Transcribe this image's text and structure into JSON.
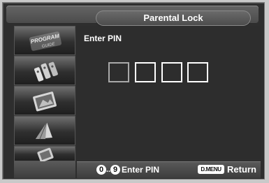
{
  "header": {
    "title": "Parental Lock"
  },
  "side_menu": {
    "items": [
      {
        "icon": "program-guide-icon",
        "caption": "PROGRAM GUIDE"
      },
      {
        "icon": "channel-icon"
      },
      {
        "icon": "picture-icon"
      },
      {
        "icon": "sound-icon"
      },
      {
        "icon": "setup-icon"
      }
    ],
    "selected_index": 0
  },
  "main": {
    "prompt": "Enter PIN",
    "pin_digits": [
      "",
      "",
      "",
      ""
    ],
    "active_digit": 0
  },
  "footer": {
    "key_from": "0",
    "key_range_sep": "..",
    "key_to": "9",
    "enter_hint": "Enter PIN",
    "menu_key": "D.MENU",
    "return_hint": "Return"
  },
  "colors": {
    "frame": "#2e2e2e",
    "outer": "#c9c9c9",
    "text": "#ffffff",
    "pin_active_border": "#a9a9a9"
  }
}
